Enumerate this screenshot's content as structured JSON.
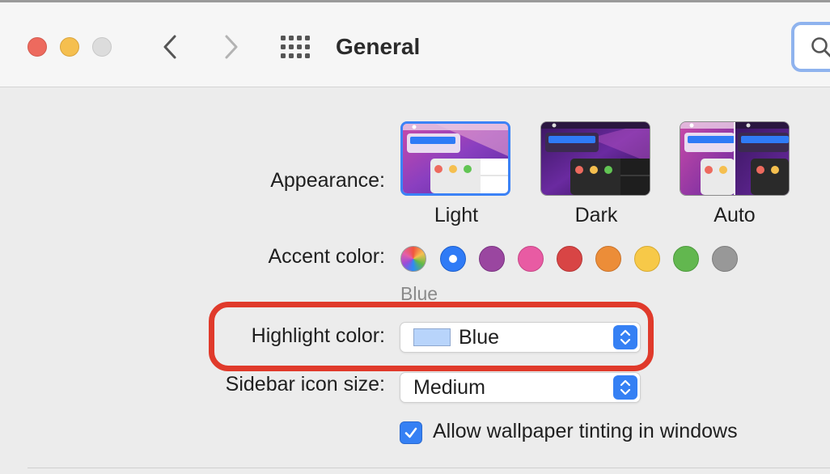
{
  "window": {
    "title": "General",
    "icons": {
      "close": "close-icon",
      "minimize": "minimize-icon",
      "zoom": "zoom-icon",
      "back": "chevron-left-icon",
      "forward": "chevron-right-icon",
      "grid": "grid-icon",
      "search": "search-icon"
    }
  },
  "appearance": {
    "label": "Appearance:",
    "options": [
      {
        "label": "Light",
        "selected": true
      },
      {
        "label": "Dark",
        "selected": false
      },
      {
        "label": "Auto",
        "selected": false
      }
    ]
  },
  "accent": {
    "label": "Accent color:",
    "selected_name": "Blue",
    "colors": [
      {
        "name": "multicolor",
        "hex": "multicolor"
      },
      {
        "name": "blue",
        "hex": "#2F7BF6",
        "selected": true
      },
      {
        "name": "purple",
        "hex": "#9A46A0"
      },
      {
        "name": "pink",
        "hex": "#E85BA3"
      },
      {
        "name": "red",
        "hex": "#D84545"
      },
      {
        "name": "orange",
        "hex": "#EC8D38"
      },
      {
        "name": "yellow",
        "hex": "#F7C948"
      },
      {
        "name": "green",
        "hex": "#62B74F"
      },
      {
        "name": "graphite",
        "hex": "#989898"
      }
    ]
  },
  "highlight": {
    "label": "Highlight color:",
    "value": "Blue",
    "chip_color": "#B8D4FB"
  },
  "sidebar": {
    "label": "Sidebar icon size:",
    "value": "Medium"
  },
  "wallpaper_tinting": {
    "label": "Allow wallpaper tinting in windows",
    "checked": true
  },
  "annotation": {
    "color": "#E03A2B",
    "target": "highlight-color"
  }
}
